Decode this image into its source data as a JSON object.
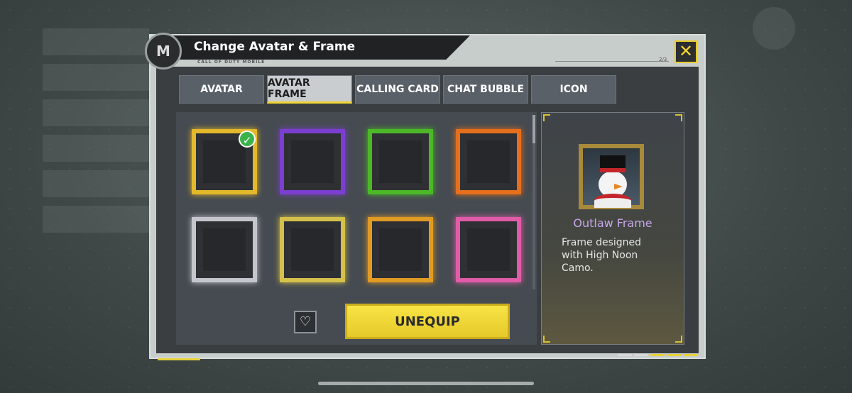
{
  "dialog": {
    "title": "Change Avatar & Frame",
    "subtitle": "CALL OF DUTY MOBILE",
    "progress": "2/3"
  },
  "tabs": [
    {
      "label": "AVATAR",
      "active": false
    },
    {
      "label": "AVATAR FRAME",
      "active": true
    },
    {
      "label": "CALLING CARD",
      "active": false
    },
    {
      "label": "CHAT BUBBLE",
      "active": false
    },
    {
      "label": "ICON",
      "active": false
    }
  ],
  "frames": [
    {
      "color": "#e3b82a",
      "equipped": true
    },
    {
      "color": "#7b3fd0",
      "equipped": false
    },
    {
      "color": "#4cb828",
      "equipped": false
    },
    {
      "color": "#e56f1c",
      "equipped": false
    },
    {
      "color": "#c3c6cc",
      "equipped": false
    },
    {
      "color": "#d4c04a",
      "equipped": false
    },
    {
      "color": "#e09b24",
      "equipped": false
    },
    {
      "color": "#e05ca8",
      "equipped": false
    }
  ],
  "actions": {
    "unequip_label": "UNEQUIP",
    "favorite_icon": "heart-icon"
  },
  "selected_item": {
    "name": "Outlaw Frame",
    "description": "Frame designed with High Noon Camo."
  },
  "colors": {
    "accent": "#f0d633",
    "name_color": "#c8a6ea"
  }
}
